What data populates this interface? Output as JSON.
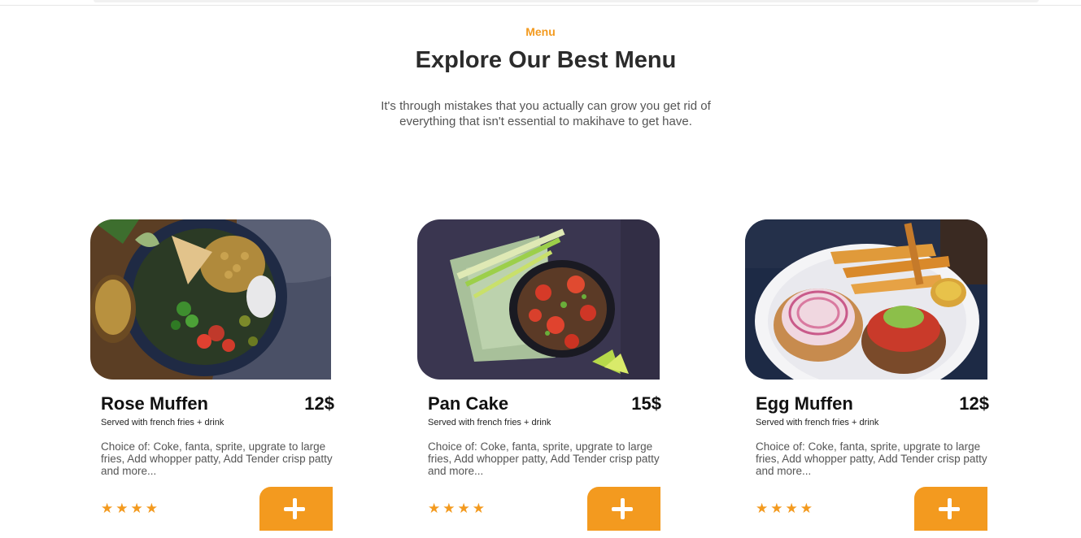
{
  "section": {
    "kicker": "Menu",
    "title": "Explore Our Best Menu",
    "subtitle": "It's through mistakes that you actually can grow you get rid of everything that isn't essential to makihave to get have."
  },
  "colors": {
    "accent": "#f39a1f",
    "heading": "#2b2b2b",
    "body_text": "#555555"
  },
  "cards": [
    {
      "name": "Rose Muffen",
      "price": "12$",
      "served": "Served with french fries + drink",
      "description": "Choice of: Coke, fanta, sprite, upgrate to large fries, Add whopper patty, Add Tender crisp patty and more...",
      "rating": 4,
      "image": "salad-bowl-photo",
      "add_icon": "plus-icon"
    },
    {
      "name": "Pan Cake",
      "price": "15$",
      "served": "Served with french fries + drink",
      "description": "Choice of: Coke, fanta, sprite, upgrate to large fries, Add whopper patty, Add Tender crisp patty and more...",
      "rating": 4,
      "image": "tomato-salad-photo",
      "add_icon": "plus-icon"
    },
    {
      "name": "Egg Muffen",
      "price": "12$",
      "served": "Served with french fries + drink",
      "description": "Choice of: Coke, fanta, sprite, upgrate to large fries, Add whopper patty, Add Tender crisp patty and more...",
      "rating": 4,
      "image": "burger-fries-photo",
      "add_icon": "plus-icon"
    }
  ]
}
